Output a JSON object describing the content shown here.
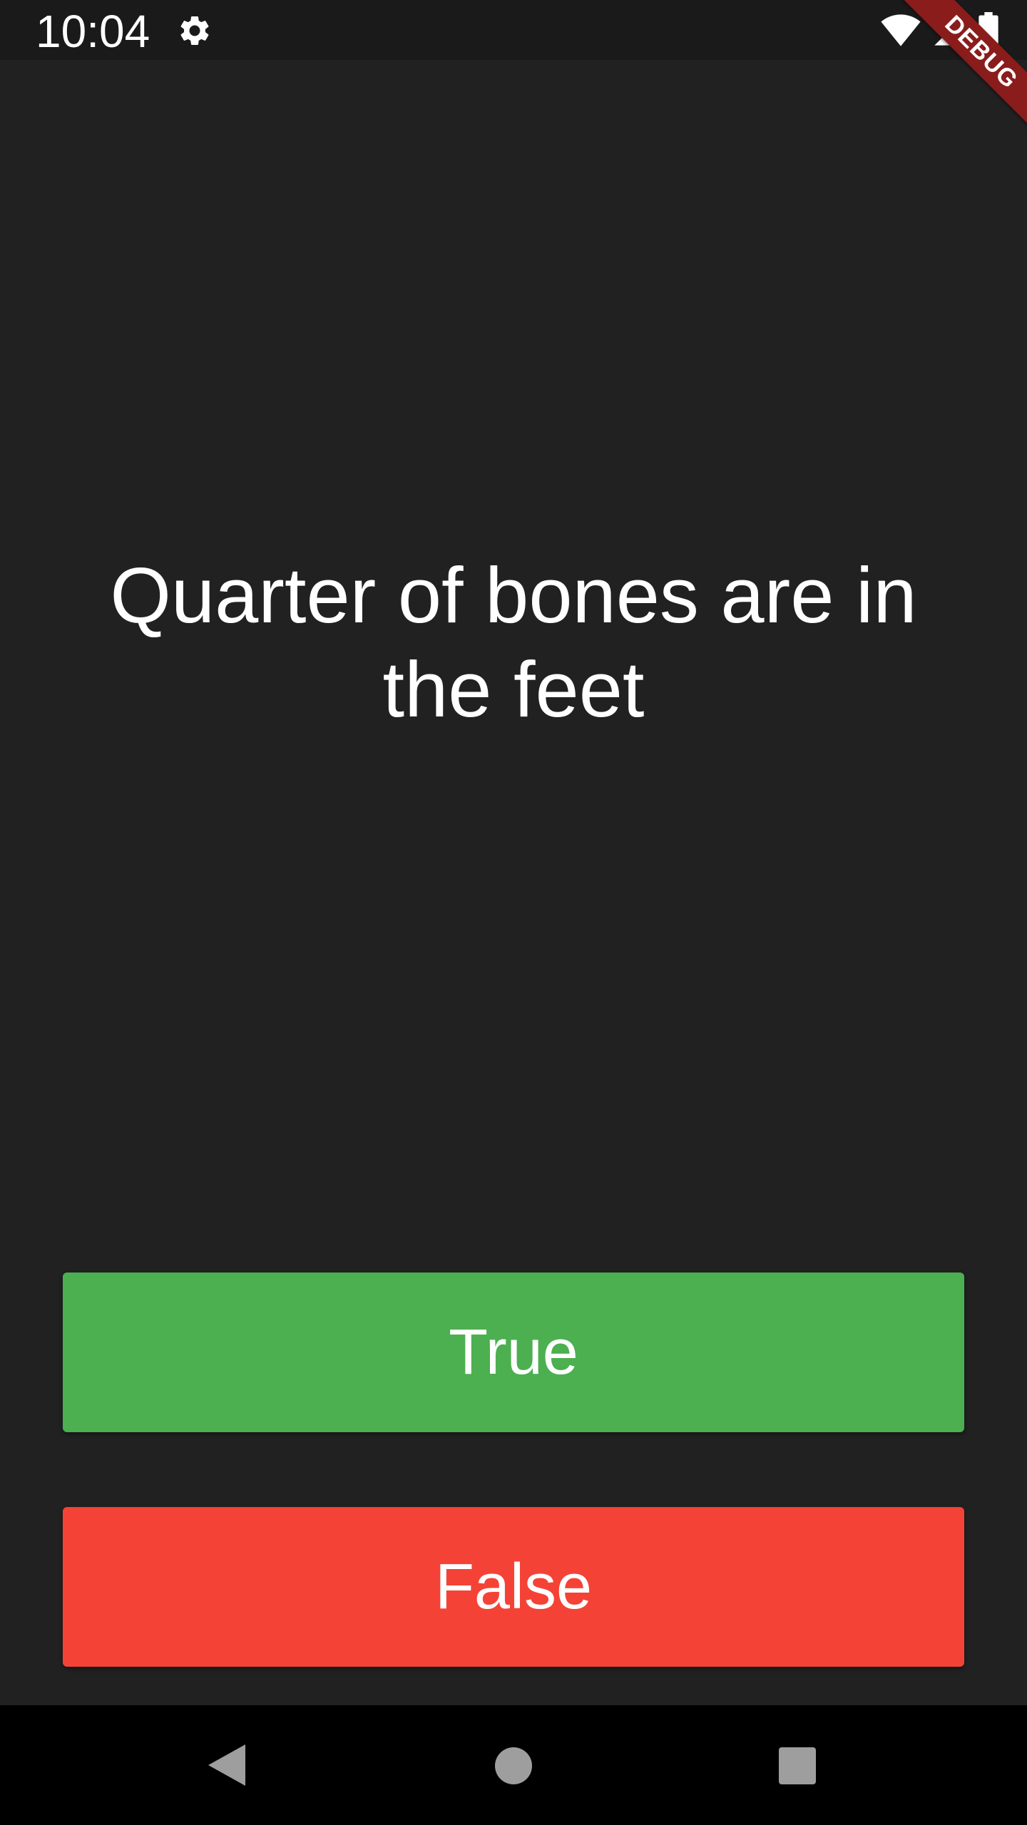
{
  "status_bar": {
    "time": "10:04",
    "icons": [
      "gear-icon",
      "wifi-icon",
      "signal-icon",
      "battery-icon"
    ]
  },
  "debug_banner": {
    "label": "DEBUG",
    "color": "#8a1c1c"
  },
  "quiz": {
    "question": "Quarter of bones are in the feet"
  },
  "buttons": {
    "true_label": "True",
    "false_label": "False",
    "true_color": "#4caf50",
    "false_color": "#f44336"
  },
  "nav_bar": {
    "icons": [
      "back-icon",
      "home-icon",
      "recents-icon"
    ]
  },
  "colors": {
    "background": "#212121",
    "text": "#ffffff"
  }
}
